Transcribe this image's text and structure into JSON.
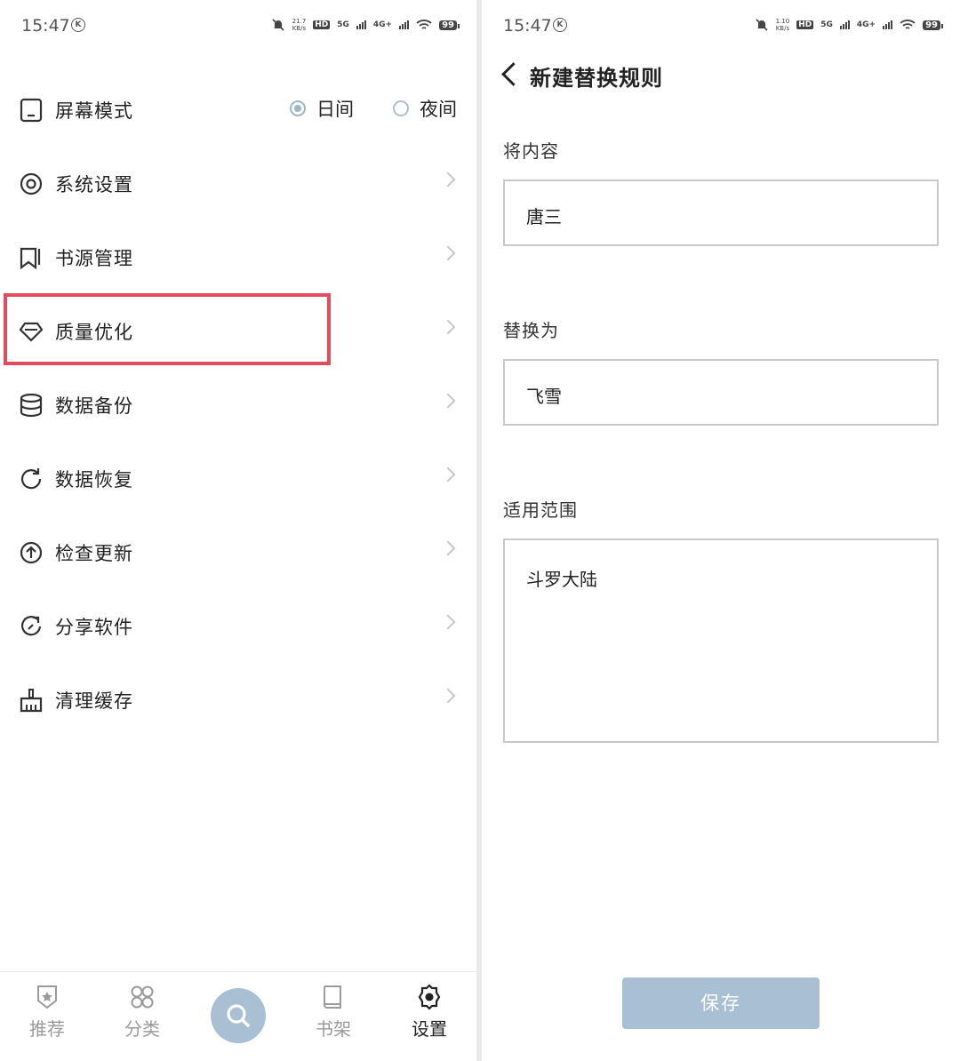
{
  "left": {
    "status": {
      "time": "15:47",
      "speed_top": "21.7",
      "speed_unit": "KB/s",
      "hd": "HD",
      "net1": "5G",
      "net2": "4G+",
      "battery": "99"
    },
    "screen_mode": {
      "label": "屏幕模式",
      "option_day": "日间",
      "option_night": "夜间"
    },
    "menu": [
      {
        "label": "系统设置"
      },
      {
        "label": "书源管理"
      },
      {
        "label": "质量优化"
      },
      {
        "label": "数据备份"
      },
      {
        "label": "数据恢复"
      },
      {
        "label": "检查更新"
      },
      {
        "label": "分享软件"
      },
      {
        "label": "清理缓存"
      }
    ],
    "nav": {
      "recommend": "推荐",
      "category": "分类",
      "bookshelf": "书架",
      "settings": "设置"
    }
  },
  "right": {
    "status": {
      "time": "15:47",
      "speed_top": "1.10",
      "speed_unit": "KB/s",
      "hd": "HD",
      "net1": "5G",
      "net2": "4G+",
      "battery": "99"
    },
    "title": "新建替换规则",
    "field1": {
      "label": "将内容",
      "value": "唐三"
    },
    "field2": {
      "label": "替换为",
      "value": "飞雪"
    },
    "field3": {
      "label": "适用范围",
      "value": "斗罗大陆"
    },
    "save_label": "保存"
  },
  "colors": {
    "accent": "#a9bfd3",
    "highlight": "#e14b5c"
  }
}
